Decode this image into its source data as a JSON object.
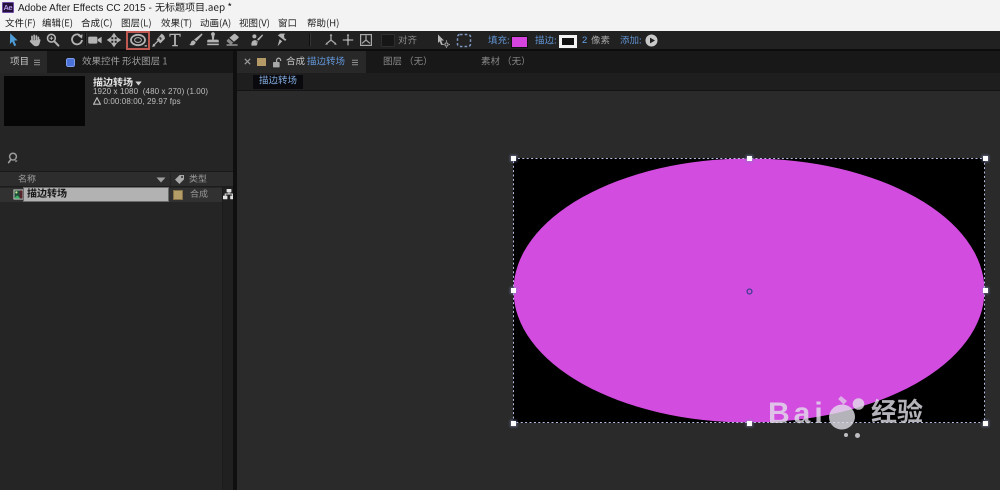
{
  "window": {
    "app_icon": "ae-logo",
    "title": "Adobe After Effects CC 2015 - 无标题项目.aep *",
    "title_prefix": "Adobe After Effects CC 2015 - ",
    "title_file": "无标题项目.aep *"
  },
  "menubar": {
    "items": [
      {
        "label": "文件(F)"
      },
      {
        "label": "编辑(E)"
      },
      {
        "label": "合成(C)"
      },
      {
        "label": "图层(L)"
      },
      {
        "label": "效果(T)"
      },
      {
        "label": "动画(A)"
      },
      {
        "label": "视图(V)"
      },
      {
        "label": "窗口"
      },
      {
        "label": "帮助(H)"
      }
    ]
  },
  "toolbar": {
    "tools": [
      {
        "name": "selection-tool",
        "active": true
      },
      {
        "name": "hand-tool"
      },
      {
        "name": "zoom-tool"
      },
      {
        "name": "rotate-tool"
      },
      {
        "name": "camera-tool"
      },
      {
        "name": "pan-behind-tool"
      },
      {
        "name": "ellipse-tool",
        "highlighted": true
      },
      {
        "name": "pen-tool"
      },
      {
        "name": "type-tool"
      },
      {
        "name": "brush-tool"
      },
      {
        "name": "clone-stamp-tool"
      },
      {
        "name": "eraser-tool"
      },
      {
        "name": "roto-brush-tool"
      },
      {
        "name": "puppet-pin-tool"
      },
      {
        "name": "local-axis-mode"
      },
      {
        "name": "world-axis-mode"
      },
      {
        "name": "view-axis-mode"
      }
    ],
    "highlight_color": "#c05a50",
    "align_label": "对齐",
    "fill_label": "填充:",
    "fill_color": "#d544de",
    "stroke_label": "描边:",
    "stroke_color": "#ffffff",
    "stroke_width": "2",
    "stroke_unit": "像素",
    "add_label": "添加:"
  },
  "project_panel": {
    "tabs": [
      {
        "label": "项目",
        "active": true
      },
      {
        "label": "效果控件 形状图层 1",
        "active": false
      }
    ],
    "preview": {
      "comp_name": "描边转场",
      "resolution_line": "1920 x 1080  (480 x 270) (1.00)",
      "duration_line": "0:00:08:00, 29.97 fps"
    },
    "search": {
      "placeholder": ""
    },
    "columns": [
      {
        "label": "名称"
      },
      {
        "label": "类型"
      }
    ],
    "rows": [
      {
        "name": "描边转场",
        "type": "合成",
        "label_color": "#b59d67",
        "selected": true,
        "renaming": true
      }
    ]
  },
  "composition_panel": {
    "tabs": [
      {
        "label": "合成",
        "comp_name": "描边转场",
        "active": true,
        "label_color": "#b39a66"
      },
      {
        "label": "图层 （无）",
        "active": false
      },
      {
        "label": "素材 （无）",
        "active": false
      }
    ],
    "breadcrumb": {
      "comp_name": "描边转场"
    },
    "viewer": {
      "comp_background": "#000000",
      "shape": {
        "type": "ellipse",
        "fill": "#d24ce0",
        "selected": true
      },
      "selection_handles": 8
    }
  },
  "watermark": {
    "brand": "Bai",
    "text": "经验",
    "name": "baidu-jingyan-watermark"
  }
}
